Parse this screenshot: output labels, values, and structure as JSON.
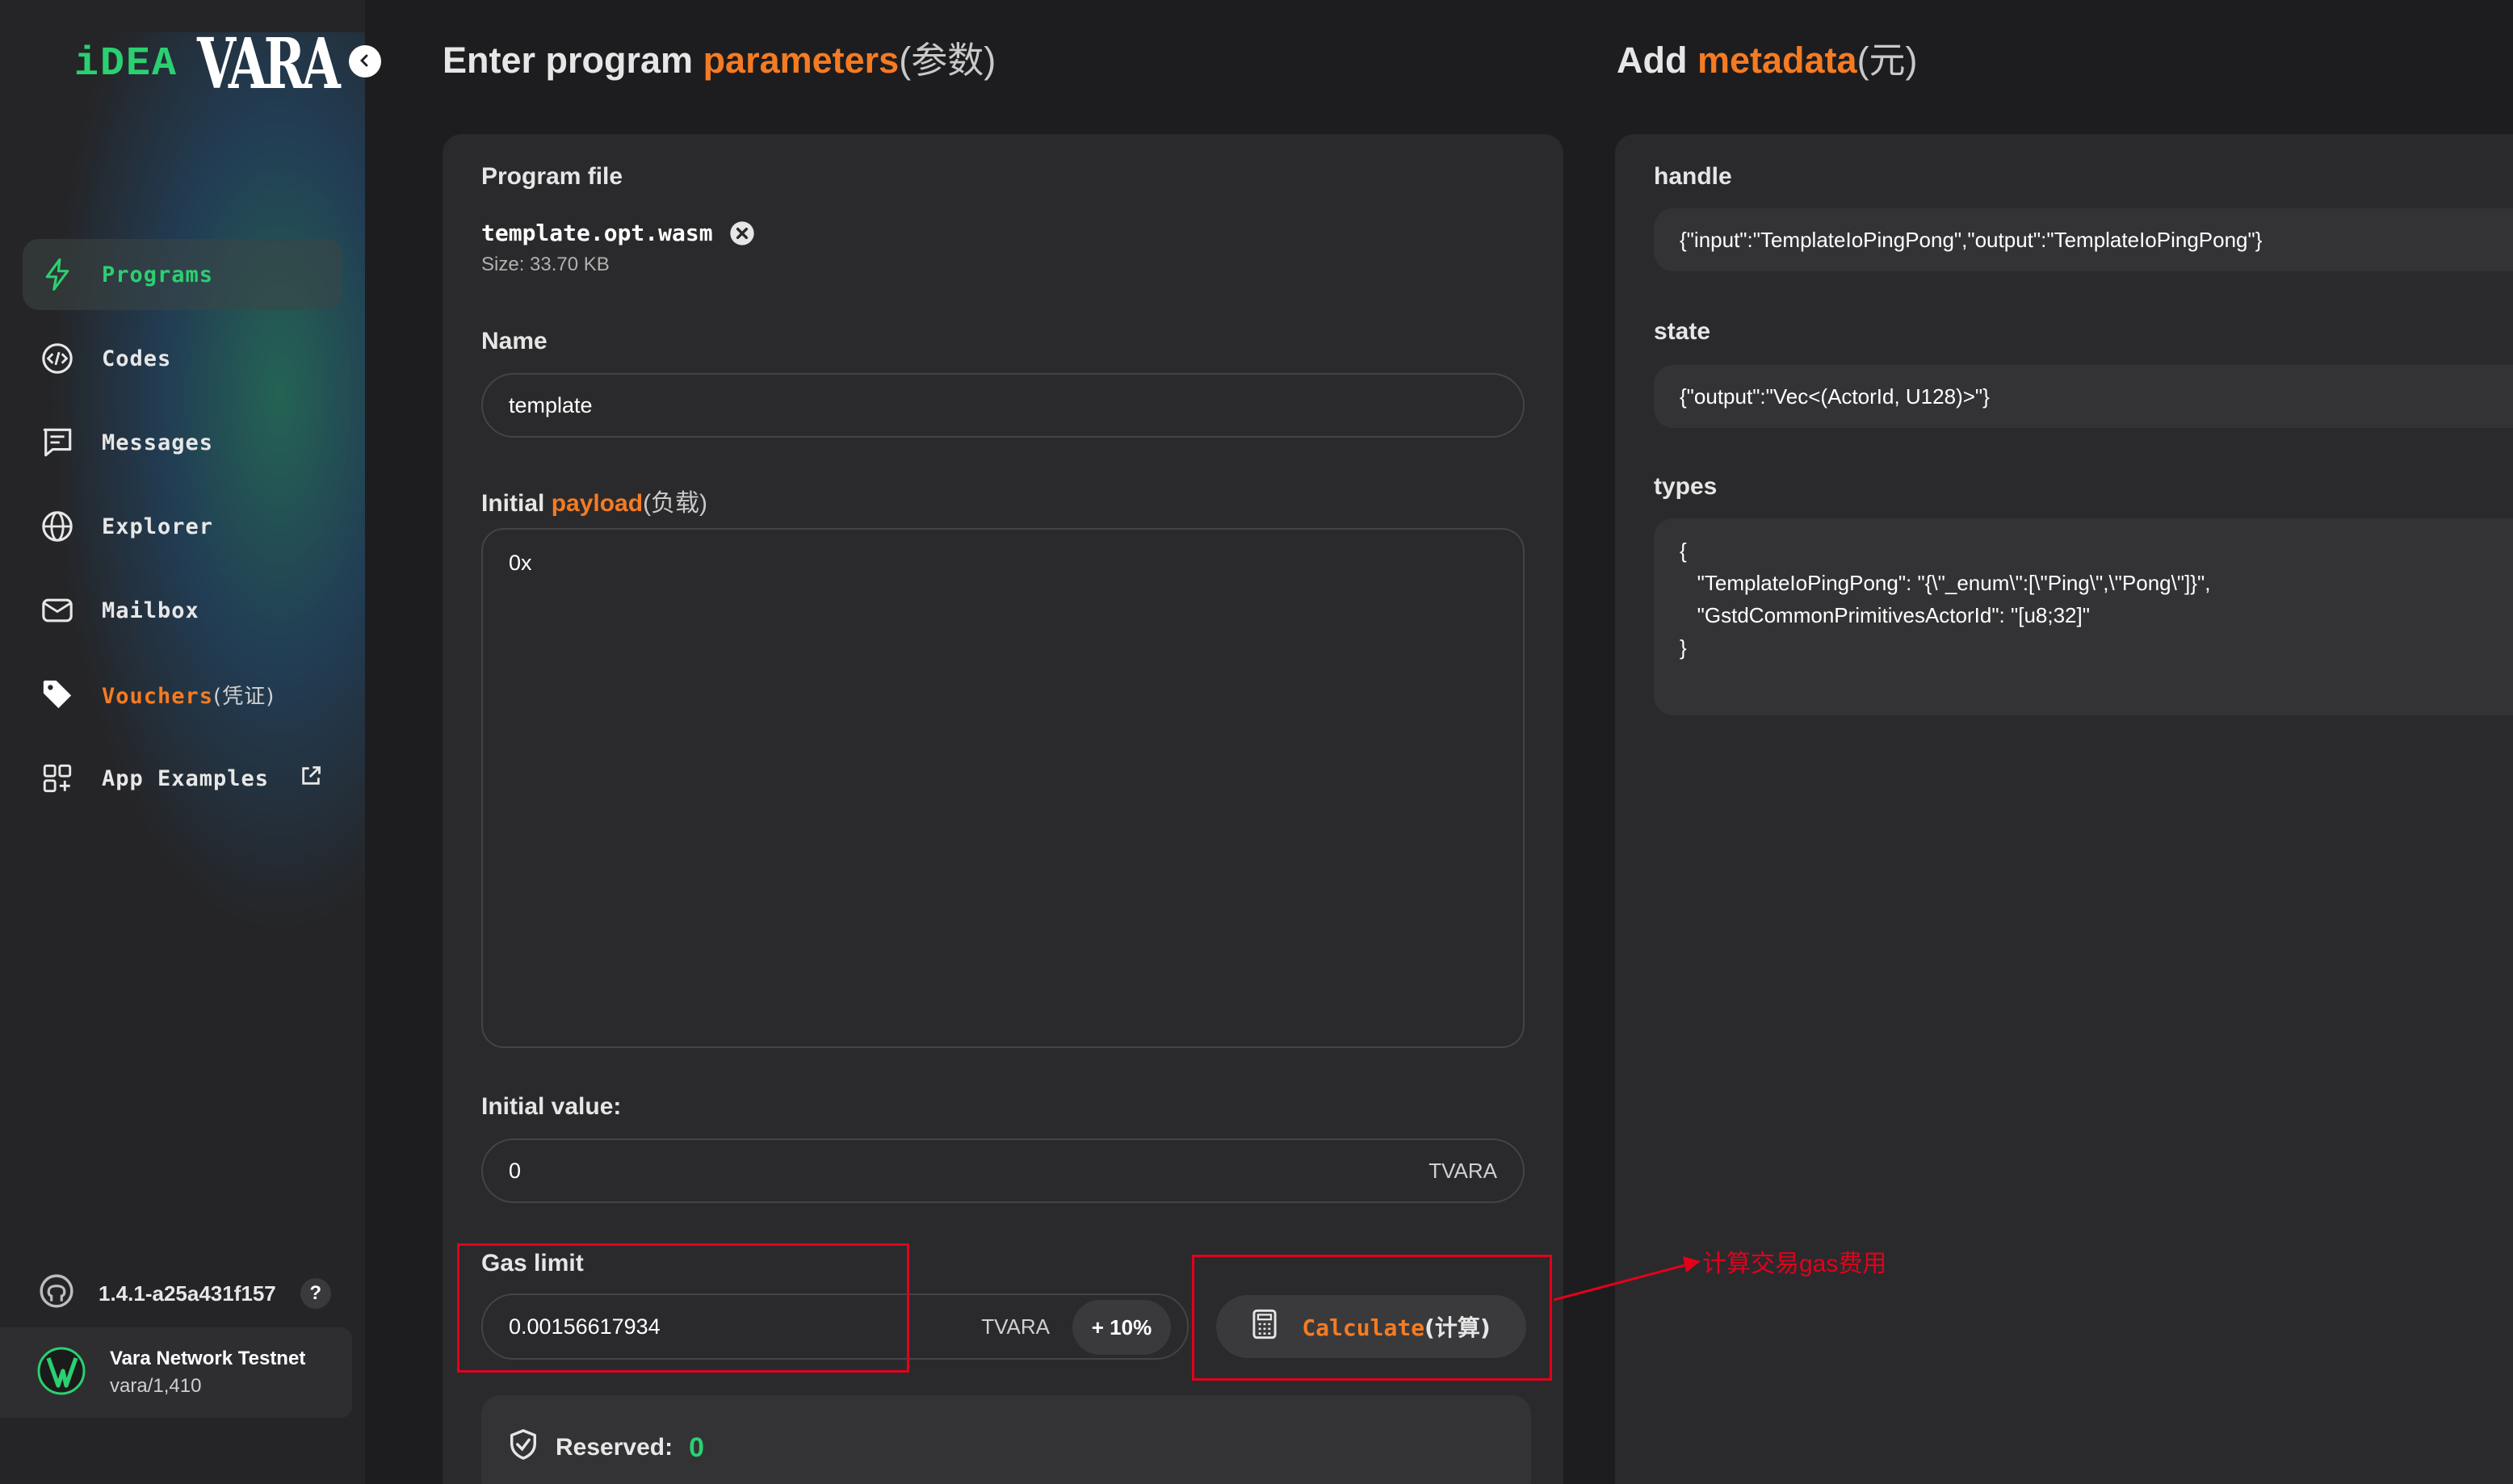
{
  "logo": {
    "idea": "iDEA",
    "vara": "VARA"
  },
  "sidebar": {
    "items": [
      {
        "label": "Programs",
        "icon": "lightning-icon",
        "active": true
      },
      {
        "label": "Codes",
        "icon": "code-icon"
      },
      {
        "label": "Messages",
        "icon": "message-icon"
      },
      {
        "label": "Explorer",
        "icon": "globe-icon"
      },
      {
        "label": "Mailbox",
        "icon": "mail-icon"
      },
      {
        "label": "Vouchers",
        "suffix": "(凭证)",
        "icon": "tag-icon"
      },
      {
        "label": "App Examples",
        "icon": "grid-icon"
      }
    ],
    "version": "1.4.1-a25a431f157",
    "help": "?",
    "network": {
      "name": "Vara Network Testnet",
      "sub": "vara/1,410"
    }
  },
  "params": {
    "title_pre": "Enter program ",
    "title_accent": "parameters",
    "title_cn": "(参数)",
    "program_file_label": "Program file",
    "file_name": "template.opt.wasm",
    "file_size": "Size: 33.70 KB",
    "name_label": "Name",
    "name_value": "template",
    "payload_label_pre": "Initial ",
    "payload_label_accent": "payload",
    "payload_label_cn": "(负载)",
    "payload_value": "0x",
    "value_label": "Initial value:",
    "value_value": "0",
    "value_unit": "TVARA",
    "gas_label": "Gas limit",
    "gas_value": "0.00156617934",
    "gas_unit": "TVARA",
    "gas_plus": "+ 10%",
    "calc_label": "Calculate",
    "calc_cn": "(计算)",
    "reserved_label": "Reserved:",
    "reserved_value": "0"
  },
  "metadata": {
    "title_pre": "Add ",
    "title_accent": "metadata",
    "title_cn": "(元)",
    "handle_label": "handle",
    "handle_value": "{\"input\":\"TemplateIoPingPong\",\"output\":\"TemplateIoPingPong\"}",
    "state_label": "state",
    "state_value": "{\"output\":\"Vec<(ActorId, U128)>\"}",
    "types_label": "types",
    "types_lines": [
      "{",
      "   \"TemplateIoPingPong\": \"{\\\"_enum\\\":[\\\"Ping\\\",\\\"Pong\\\"]}\",",
      "   \"GstdCommonPrimitivesActorId\": \"[u8;32]\"",
      "}"
    ]
  },
  "annotation": {
    "text": "计算交易gas费用",
    "color": "#e3001b"
  },
  "colors": {
    "accent": "#f57b22",
    "green": "#2bd071",
    "bg": "#1d1d1f",
    "card": "#2a2a2c"
  }
}
